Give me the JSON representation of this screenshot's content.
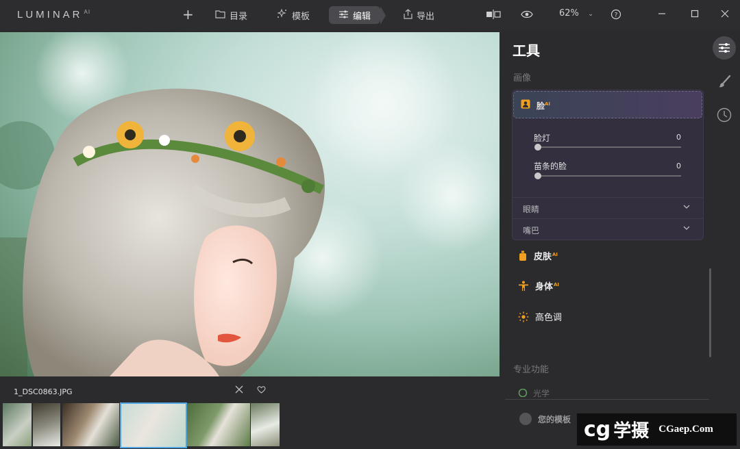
{
  "app": {
    "logo": "LUMINAR",
    "logo_suffix": "AI"
  },
  "nav": {
    "add_label": "+",
    "catalog_label": "目录",
    "templates_label": "模板",
    "edit_label": "编辑",
    "export_label": "导出"
  },
  "toolbar": {
    "zoom": "62%"
  },
  "image": {
    "filename": "1_DSC0863.JPG",
    "thumbnail_count": 6,
    "selected_thumbnail": 4
  },
  "panel": {
    "title": "工具",
    "section_image": "画像",
    "face": {
      "label": "脸",
      "badge": "AI",
      "sliders": [
        {
          "label": "脸灯",
          "value": "0"
        },
        {
          "label": "苗条的脸",
          "value": "0"
        }
      ],
      "eyes_label": "眼睛",
      "mouth_label": "嘴巴"
    },
    "tools": [
      {
        "label": "皮肤",
        "badge": "AI"
      },
      {
        "label": "身体",
        "badge": "AI"
      },
      {
        "label": "高色调",
        "badge": ""
      }
    ],
    "section_pro": "专业功能",
    "pro_partial": "光学",
    "my_templates": "您的模板"
  },
  "watermark": {
    "brand": "学摄",
    "site": "CGaep.Com"
  },
  "colors": {
    "accent_orange": "#f0a020",
    "active_thumb_border": "#4fa3e0",
    "panel_bg": "#2b2b2d"
  }
}
